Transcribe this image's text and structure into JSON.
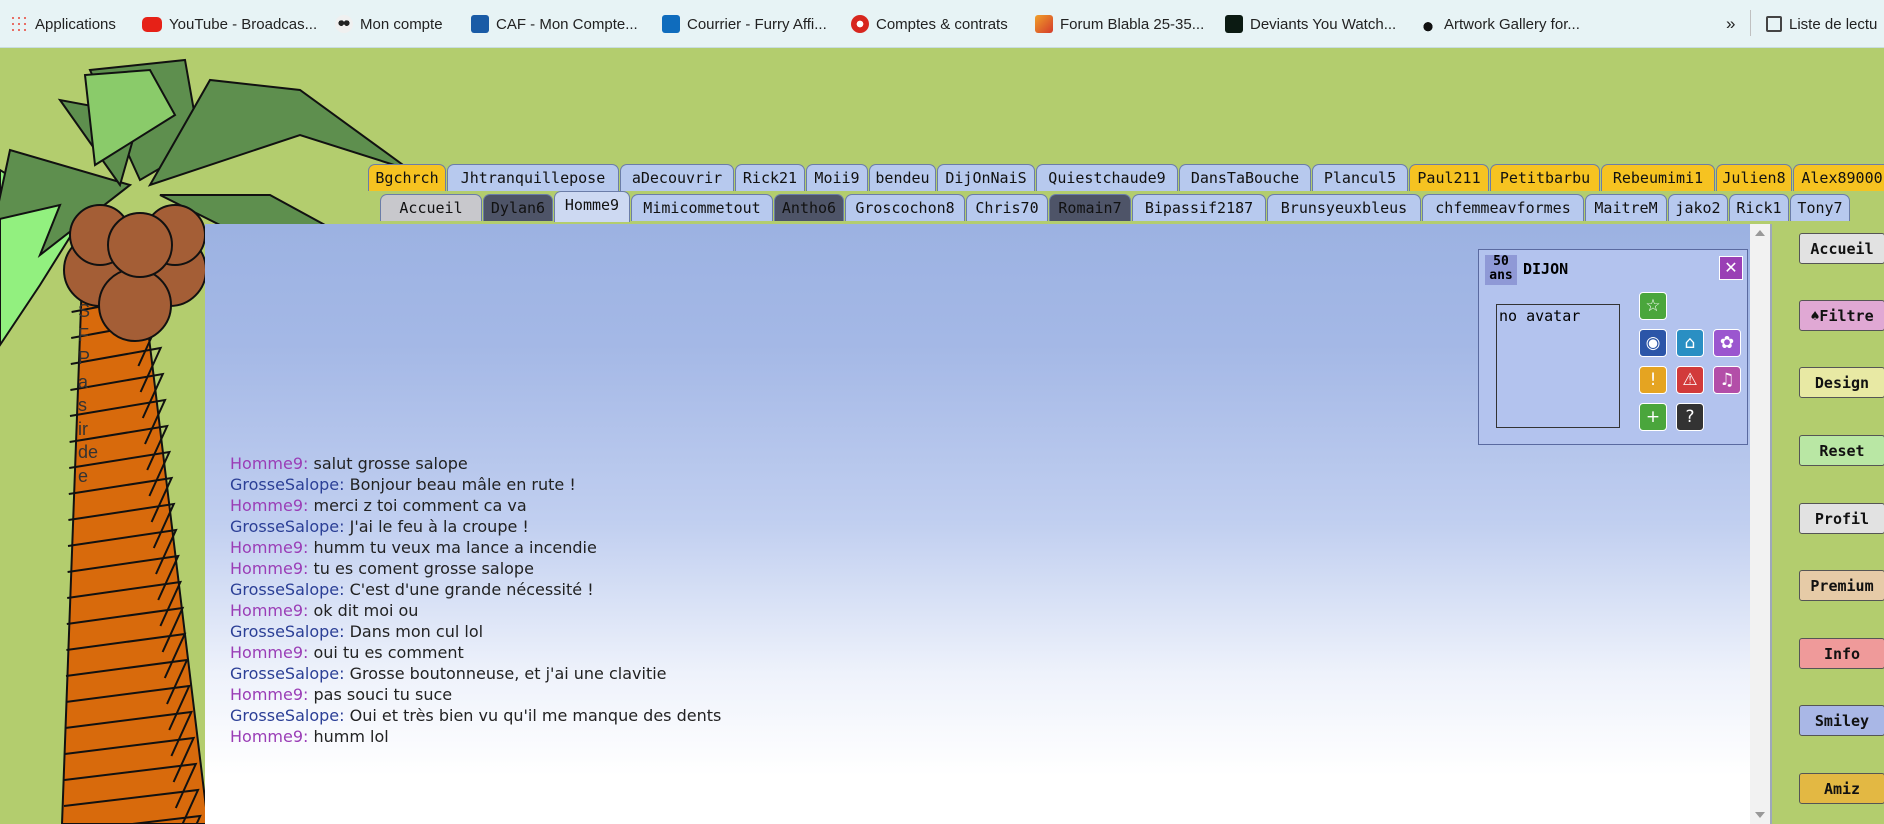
{
  "bookmarks": [
    {
      "label": "Applications",
      "icon": "apps-grid-icon"
    },
    {
      "label": "YouTube - Broadcas...",
      "icon": "youtube-icon"
    },
    {
      "label": "Mon compte",
      "icon": "panda-icon"
    },
    {
      "label": "CAF - Mon Compte...",
      "icon": "caf-icon"
    },
    {
      "label": "Courrier - Furry Affi...",
      "icon": "outlook-icon"
    },
    {
      "label": "Comptes & contrats",
      "icon": "contracts-icon"
    },
    {
      "label": "Forum Blabla 25-35...",
      "icon": "jv-icon"
    },
    {
      "label": "Deviants You Watch...",
      "icon": "deviantart-icon"
    },
    {
      "label": "Artwork Gallery for...",
      "icon": "paw-icon"
    }
  ],
  "bookmarks_more": "»",
  "reading_list": "Liste de lectu",
  "tabs_row1": [
    "Bgchrch",
    "Jhtranquillepose",
    "aDecouvrir",
    "Rick21",
    "Moii9",
    "bendeu",
    "DijOnNaiS",
    "Quiestchaude9",
    "DansTaBouche",
    "Plancul5",
    "Paul211",
    "Petitbarbu",
    "Rebeumimi1",
    "Julien8",
    "Alex89000"
  ],
  "tabs_row2": [
    "Accueil",
    "Dylan6",
    "Homme9",
    "Mimicommetout",
    "Antho6",
    "Groscochon8",
    "Chris70",
    "Romain7",
    "Bipassif2187",
    "Brunsyeuxbleus",
    "chfemmeavformes",
    "MaitreM",
    "jako2",
    "Rick1",
    "Tony7"
  ],
  "profile": {
    "age": "50",
    "age_unit": "ans",
    "city": "DIJON",
    "avatar_text": "no avatar",
    "close": "✕"
  },
  "sidebar_buttons": [
    "Accueil",
    "♠Filtre",
    "Design",
    "Reset",
    "Profil",
    "Premium",
    "Info",
    "Smiley",
    "Amiz"
  ],
  "messages": [
    {
      "user": "Homme9:",
      "text": "salut grosse salope",
      "who": "h"
    },
    {
      "user": "GrosseSalope:",
      "text": "Bonjour beau mâle en rute !",
      "who": "g"
    },
    {
      "user": "Homme9:",
      "text": "merci z toi comment ca va",
      "who": "h"
    },
    {
      "user": "GrosseSalope:",
      "text": "J'ai le feu à la croupe !",
      "who": "g"
    },
    {
      "user": "Homme9:",
      "text": "humm tu veux ma lance a incendie",
      "who": "h"
    },
    {
      "user": "Homme9:",
      "text": "tu es coment grosse salope",
      "who": "h"
    },
    {
      "user": "GrosseSalope:",
      "text": "C'est d'une grande nécessité !",
      "who": "g"
    },
    {
      "user": "Homme9:",
      "text": "ok dit moi ou",
      "who": "h"
    },
    {
      "user": "GrosseSalope:",
      "text": "Dans mon cul lol",
      "who": "g"
    },
    {
      "user": "Homme9:",
      "text": "oui tu es comment",
      "who": "h"
    },
    {
      "user": "GrosseSalope:",
      "text": "Grosse boutonneuse, et j'ai une clavitie",
      "who": "g"
    },
    {
      "user": "Homme9:",
      "text": "pas souci tu suce",
      "who": "h"
    },
    {
      "user": "GrosseSalope:",
      "text": "Oui et très bien vu qu'il me manque des dents",
      "who": "g"
    },
    {
      "user": "Homme9:",
      "text": "humm lol",
      "who": "h"
    }
  ],
  "left_text_fragments": [
    "S",
    "F",
    "P",
    "a",
    "s",
    "ir",
    "de",
    "e"
  ],
  "colors": {
    "background": "#b3cd6e",
    "tab_yellow": "#f6c321",
    "tab_blue": "#b7c9ee",
    "tab_dark": "#4e5468",
    "name_homme": "#9a3db6",
    "name_grosse": "#2b3f96"
  }
}
